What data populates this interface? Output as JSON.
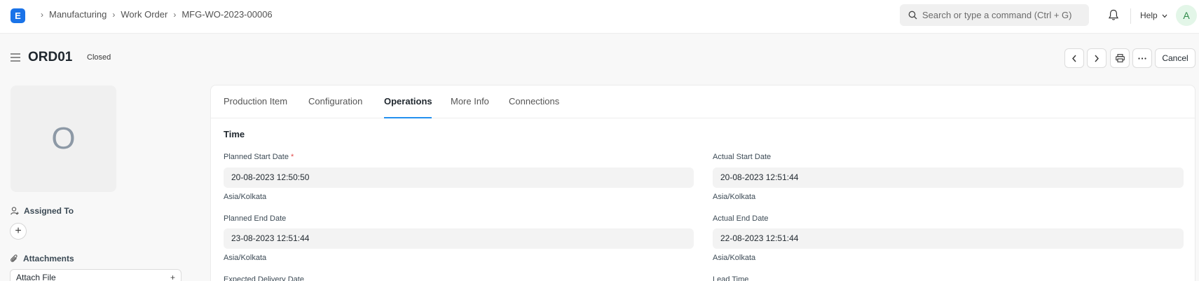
{
  "navbar": {
    "logo": "E",
    "breadcrumbs": [
      "Manufacturing",
      "Work Order",
      "MFG-WO-2023-00006"
    ],
    "search_placeholder": "Search or type a command (Ctrl + G)",
    "help_label": "Help",
    "avatar_initial": "A"
  },
  "page": {
    "title": "ORD01",
    "status": "Closed",
    "cancel_label": "Cancel"
  },
  "sidebar": {
    "image_initial": "O",
    "assigned_to_label": "Assigned To",
    "attachments_label": "Attachments",
    "attach_file_label": "Attach File",
    "add_symbol": "+"
  },
  "tabs": [
    "Production Item",
    "Configuration",
    "Operations",
    "More Info",
    "Connections"
  ],
  "active_tab": "Operations",
  "section": {
    "title": "Time",
    "fields": {
      "planned_start_date": {
        "label": "Planned Start Date",
        "required_mark": "*",
        "value": "20-08-2023 12:50:50",
        "timezone": "Asia/Kolkata"
      },
      "actual_start_date": {
        "label": "Actual Start Date",
        "value": "20-08-2023 12:51:44",
        "timezone": "Asia/Kolkata"
      },
      "planned_end_date": {
        "label": "Planned End Date",
        "value": "23-08-2023 12:51:44",
        "timezone": "Asia/Kolkata"
      },
      "actual_end_date": {
        "label": "Actual End Date",
        "value": "22-08-2023 12:51:44",
        "timezone": "Asia/Kolkata"
      },
      "expected_delivery_date": {
        "label": "Expected Delivery Date"
      },
      "lead_time": {
        "label": "Lead Time"
      }
    }
  },
  "colors": {
    "brand": "#1a73e8",
    "tab_accent": "#2490ef",
    "required": "#e24c4c"
  }
}
